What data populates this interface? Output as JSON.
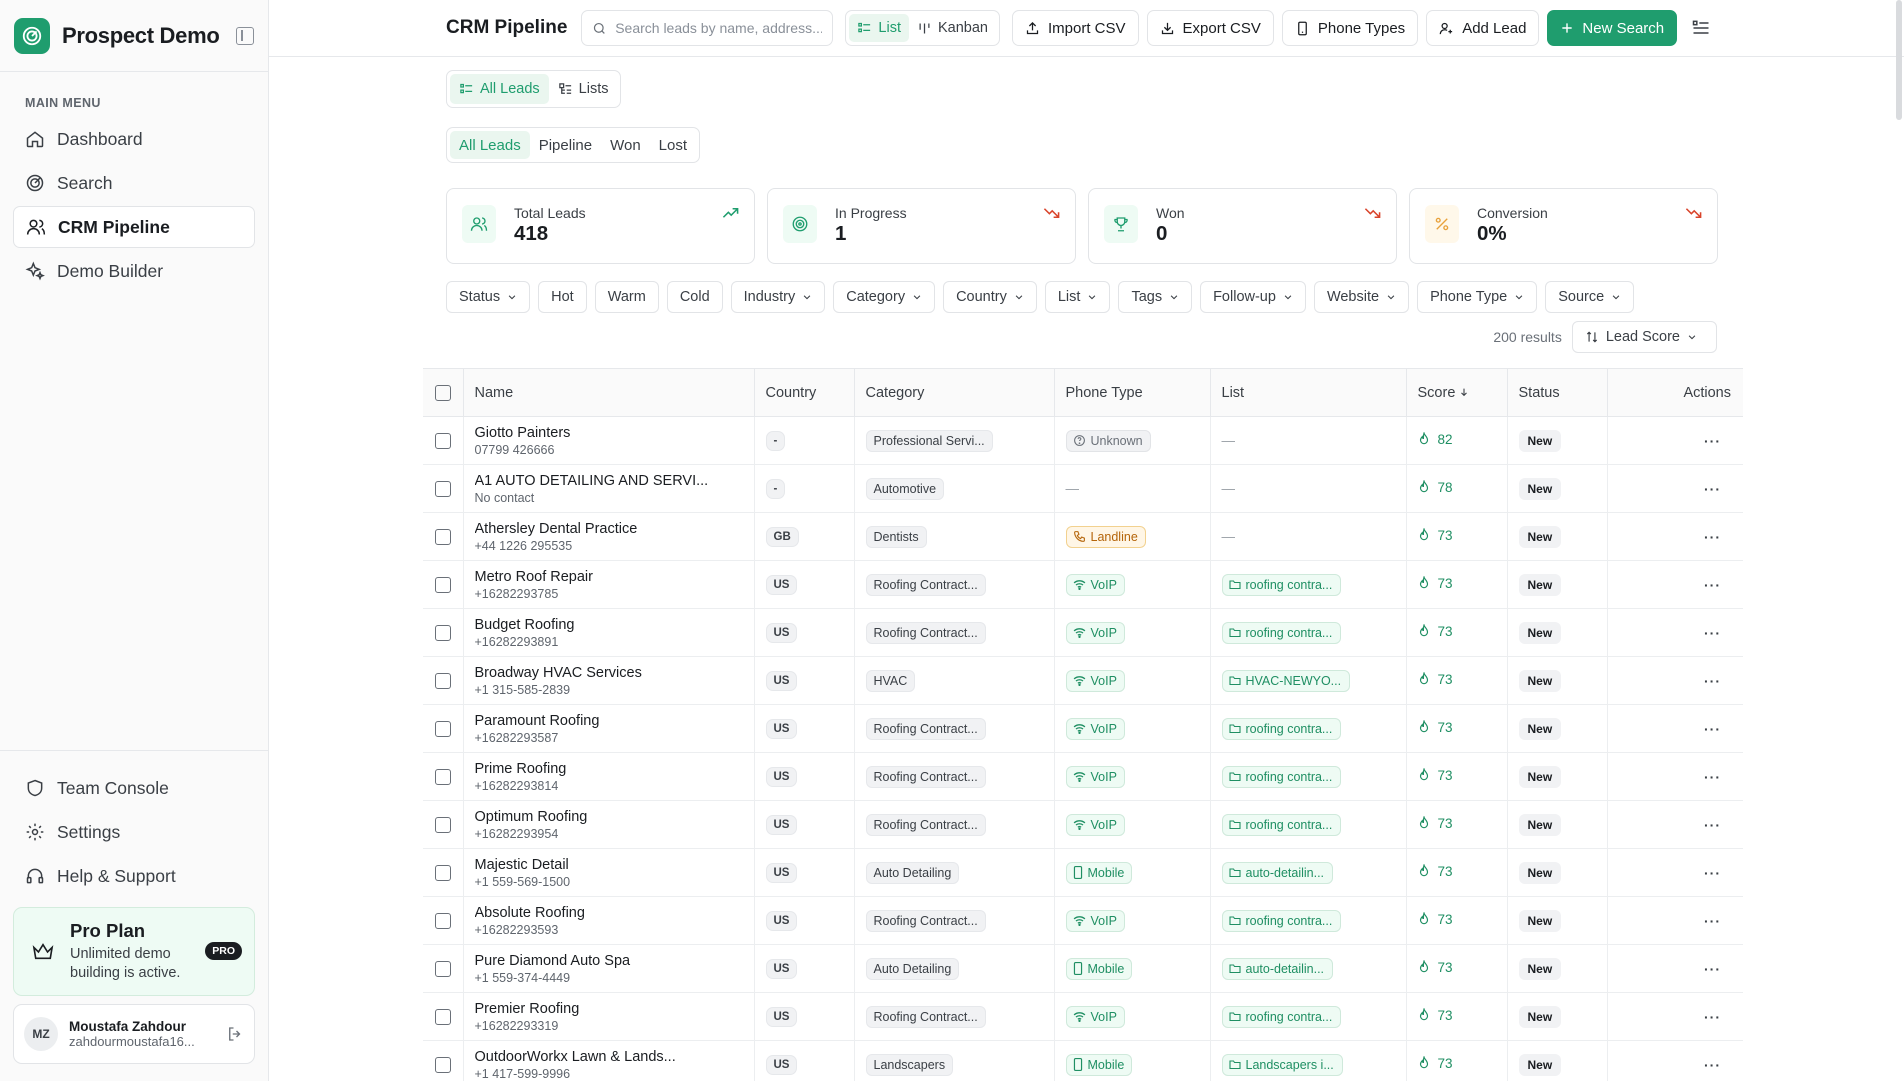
{
  "brand": {
    "name": "Prospect Demo"
  },
  "sidebar": {
    "menu_label": "MAIN MENU",
    "items": [
      {
        "label": "Dashboard",
        "icon": "home-icon"
      },
      {
        "label": "Search",
        "icon": "radar-icon"
      },
      {
        "label": "CRM Pipeline",
        "icon": "users-icon",
        "active": true
      },
      {
        "label": "Demo Builder",
        "icon": "sparkles-icon"
      }
    ],
    "bottom_items": [
      {
        "label": "Team Console",
        "icon": "shield-icon"
      },
      {
        "label": "Settings",
        "icon": "gear-icon"
      },
      {
        "label": "Help & Support",
        "icon": "headset-icon"
      }
    ],
    "plan": {
      "title": "Pro Plan",
      "desc": "Unlimited demo building is active.",
      "badge": "PRO"
    },
    "user": {
      "initials": "MZ",
      "name": "Moustafa Zahdour",
      "email": "zahdourmoustafa16..."
    }
  },
  "topbar": {
    "title": "CRM Pipeline",
    "search_placeholder": "Search leads by name, address...",
    "view_list": "List",
    "view_kanban": "Kanban",
    "import": "Import CSV",
    "export": "Export CSV",
    "phone_types": "Phone Types",
    "add_lead": "Add Lead",
    "new_search": "New Search"
  },
  "subtabs": {
    "all": "All Leads",
    "lists": "Lists"
  },
  "stage_tabs": [
    "All Leads",
    "Pipeline",
    "Won",
    "Lost"
  ],
  "stats": [
    {
      "label": "Total Leads",
      "value": "418",
      "icon": "users-icon",
      "trend": "up",
      "color": "#1f9d6e",
      "bg": "#eefbf4"
    },
    {
      "label": "In Progress",
      "value": "1",
      "icon": "target-icon",
      "trend": "down",
      "color": "#1f9d6e",
      "bg": "#eefbf4"
    },
    {
      "label": "Won",
      "value": "0",
      "icon": "trophy-icon",
      "trend": "down",
      "color": "#1f9d6e",
      "bg": "#eefbf4"
    },
    {
      "label": "Conversion",
      "value": "0%",
      "icon": "percent-icon",
      "trend": "down",
      "color": "#e8a13a",
      "bg": "#fff8ea"
    }
  ],
  "filters": [
    {
      "label": "Status",
      "caret": true
    },
    {
      "label": "Hot",
      "caret": false
    },
    {
      "label": "Warm",
      "caret": false
    },
    {
      "label": "Cold",
      "caret": false
    },
    {
      "label": "Industry",
      "caret": true
    },
    {
      "label": "Category",
      "caret": true
    },
    {
      "label": "Country",
      "caret": true
    },
    {
      "label": "List",
      "caret": true
    },
    {
      "label": "Tags",
      "caret": true
    },
    {
      "label": "Follow-up",
      "caret": true
    },
    {
      "label": "Website",
      "caret": true
    },
    {
      "label": "Phone Type",
      "caret": true
    },
    {
      "label": "Source",
      "caret": true
    }
  ],
  "results": {
    "count": "200 results",
    "sort": "Lead Score"
  },
  "table": {
    "columns": [
      "Name",
      "Country",
      "Category",
      "Phone Type",
      "List",
      "Score",
      "Status",
      "Actions"
    ],
    "rows": [
      {
        "name": "Giotto Painters",
        "contact": "07799 426666",
        "country": "-",
        "category": "Professional Servi...",
        "phone": "Unknown",
        "list": "",
        "score": "82",
        "status": "New"
      },
      {
        "name": "A1 AUTO DETAILING AND SERVI...",
        "contact": "No contact",
        "country": "-",
        "category": "Automotive",
        "phone": "",
        "list": "",
        "score": "78",
        "status": "New"
      },
      {
        "name": "Athersley Dental Practice",
        "contact": "+44 1226 295535",
        "country": "GB",
        "category": "Dentists",
        "phone": "Landline",
        "list": "",
        "score": "73",
        "status": "New"
      },
      {
        "name": "Metro Roof Repair",
        "contact": "+16282293785",
        "country": "US",
        "category": "Roofing Contract...",
        "phone": "VoIP",
        "list": "roofing contra...",
        "score": "73",
        "status": "New"
      },
      {
        "name": "Budget Roofing",
        "contact": "+16282293891",
        "country": "US",
        "category": "Roofing Contract...",
        "phone": "VoIP",
        "list": "roofing contra...",
        "score": "73",
        "status": "New"
      },
      {
        "name": "Broadway HVAC Services",
        "contact": "+1 315-585-2839",
        "country": "US",
        "category": "HVAC",
        "phone": "VoIP",
        "list": "HVAC-NEWYO...",
        "score": "73",
        "status": "New"
      },
      {
        "name": "Paramount Roofing",
        "contact": "+16282293587",
        "country": "US",
        "category": "Roofing Contract...",
        "phone": "VoIP",
        "list": "roofing contra...",
        "score": "73",
        "status": "New"
      },
      {
        "name": "Prime Roofing",
        "contact": "+16282293814",
        "country": "US",
        "category": "Roofing Contract...",
        "phone": "VoIP",
        "list": "roofing contra...",
        "score": "73",
        "status": "New"
      },
      {
        "name": "Optimum Roofing",
        "contact": "+16282293954",
        "country": "US",
        "category": "Roofing Contract...",
        "phone": "VoIP",
        "list": "roofing contra...",
        "score": "73",
        "status": "New"
      },
      {
        "name": "Majestic Detail",
        "contact": "+1 559-569-1500",
        "country": "US",
        "category": "Auto Detailing",
        "phone": "Mobile",
        "list": "auto-detailin...",
        "score": "73",
        "status": "New"
      },
      {
        "name": "Absolute Roofing",
        "contact": "+16282293593",
        "country": "US",
        "category": "Roofing Contract...",
        "phone": "VoIP",
        "list": "roofing contra...",
        "score": "73",
        "status": "New"
      },
      {
        "name": "Pure Diamond Auto Spa",
        "contact": "+1 559-374-4449",
        "country": "US",
        "category": "Auto Detailing",
        "phone": "Mobile",
        "list": "auto-detailin...",
        "score": "73",
        "status": "New"
      },
      {
        "name": "Premier Roofing",
        "contact": "+16282293319",
        "country": "US",
        "category": "Roofing Contract...",
        "phone": "VoIP",
        "list": "roofing contra...",
        "score": "73",
        "status": "New"
      },
      {
        "name": "OutdoorWorkx Lawn & Lands...",
        "contact": "+1 417-599-9996",
        "country": "US",
        "category": "Landscapers",
        "phone": "Mobile",
        "list": "Landscapers i...",
        "score": "73",
        "status": "New"
      }
    ]
  },
  "colors": {
    "accent": "#1f9d6e",
    "trend_up": "#1f9d6e",
    "trend_down": "#d9442b"
  }
}
